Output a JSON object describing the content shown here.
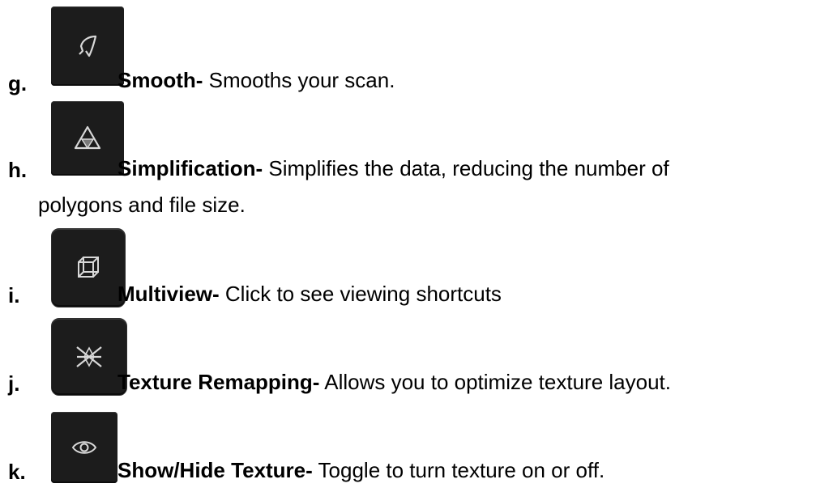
{
  "items": [
    {
      "marker": "g.",
      "title": "Smooth-",
      "text": "Smooths your scan.",
      "icon": "smooth-icon"
    },
    {
      "marker": "h.",
      "title": "Simplification-",
      "text": "Simplifies the data, reducing the number of",
      "continuation": "polygons and file size.",
      "icon": "simplification-icon"
    },
    {
      "marker": "i.",
      "title": "Multiview-",
      "text": "Click to see viewing shortcuts",
      "icon": "multiview-cube-icon"
    },
    {
      "marker": "j.",
      "title": "Texture Remapping-",
      "text": "Allows you to optimize texture layout.",
      "icon": "texture-remapping-icon"
    },
    {
      "marker": "k.",
      "title": "Show/Hide Texture-",
      "text": "Toggle to turn texture on or off.",
      "icon": "eye-icon"
    }
  ],
  "colors": {
    "button_bg": "#1c1c1c",
    "icon_stroke": "#d8d8d8"
  }
}
